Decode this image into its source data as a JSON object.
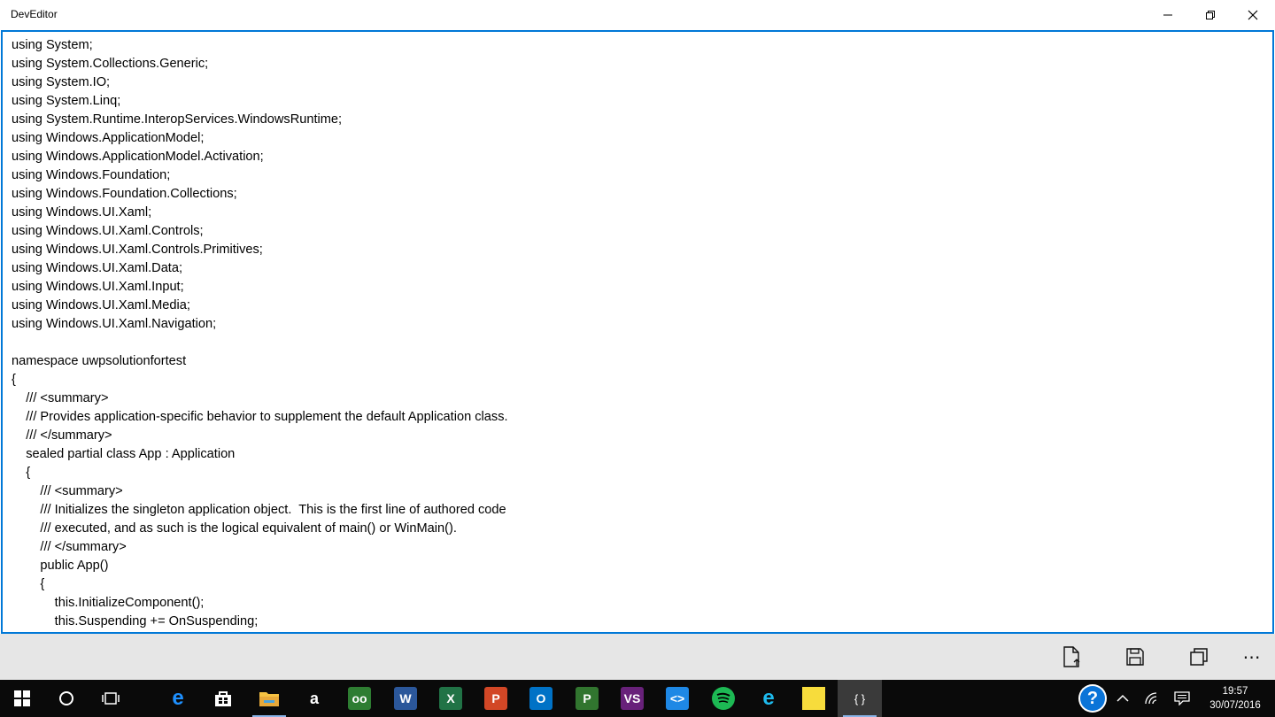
{
  "window": {
    "title": "DevEditor"
  },
  "editor": {
    "lines": [
      "using System;",
      "using System.Collections.Generic;",
      "using System.IO;",
      "using System.Linq;",
      "using System.Runtime.InteropServices.WindowsRuntime;",
      "using Windows.ApplicationModel;",
      "using Windows.ApplicationModel.Activation;",
      "using Windows.Foundation;",
      "using Windows.Foundation.Collections;",
      "using Windows.UI.Xaml;",
      "using Windows.UI.Xaml.Controls;",
      "using Windows.UI.Xaml.Controls.Primitives;",
      "using Windows.UI.Xaml.Data;",
      "using Windows.UI.Xaml.Input;",
      "using Windows.UI.Xaml.Media;",
      "using Windows.UI.Xaml.Navigation;",
      "",
      "namespace uwpsolutionfortest",
      "{",
      "    /// <summary>",
      "    /// Provides application-specific behavior to supplement the default Application class.",
      "    /// </summary>",
      "    sealed partial class App : Application",
      "    {",
      "        /// <summary>",
      "        /// Initializes the singleton application object.  This is the first line of authored code",
      "        /// executed, and as such is the logical equivalent of main() or WinMain().",
      "        /// </summary>",
      "        public App()",
      "        {",
      "            this.InitializeComponent();",
      "            this.Suspending += OnSuspending;"
    ]
  },
  "appbar": {
    "more_label": "⋯"
  },
  "taskbar": {
    "items": [
      {
        "name": "edge",
        "glyph": "e",
        "color": "#1e90ff"
      },
      {
        "name": "store",
        "glyph": "",
        "color": "#ffffff"
      },
      {
        "name": "file-explorer",
        "glyph": "",
        "color": "#f5c242"
      },
      {
        "name": "amazon",
        "glyph": "a",
        "color": "#ffffff"
      },
      {
        "name": "tripadvisor",
        "glyph": "oo",
        "color": "#2e7d32"
      },
      {
        "name": "word",
        "glyph": "W",
        "color": "#2b579a"
      },
      {
        "name": "excel",
        "glyph": "X",
        "color": "#217346"
      },
      {
        "name": "powerpoint",
        "glyph": "P",
        "color": "#d24726"
      },
      {
        "name": "outlook",
        "glyph": "O",
        "color": "#0072c6"
      },
      {
        "name": "project",
        "glyph": "P",
        "color": "#31752f"
      },
      {
        "name": "visual-studio",
        "glyph": "VS",
        "color": "#68217a"
      },
      {
        "name": "vs-code",
        "glyph": "<>",
        "color": "#1e88e5"
      },
      {
        "name": "spotify",
        "glyph": "",
        "color": "#1db954"
      },
      {
        "name": "internet-explorer",
        "glyph": "e",
        "color": "#1ebbee"
      },
      {
        "name": "sticky-notes",
        "glyph": "",
        "color": "#f7dc3c"
      },
      {
        "name": "deveditor",
        "glyph": "{ }",
        "color": "#3a3a3a"
      }
    ],
    "help_glyph": "?",
    "clock_time": "19:57",
    "clock_date": "30/07/2016"
  },
  "colors": {
    "accent": "#0078d7",
    "appbar": "#e6e6e6",
    "taskbar": "#0a0a0a"
  }
}
